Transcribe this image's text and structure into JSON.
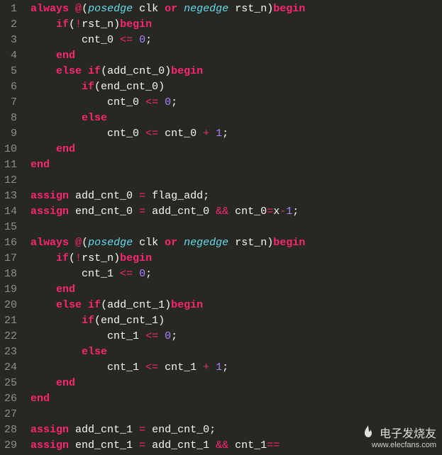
{
  "lines": [
    {
      "n": 1,
      "tokens": [
        [
          " ",
          "pn"
        ],
        [
          "always",
          "kw"
        ],
        [
          " ",
          "pn"
        ],
        [
          "@",
          "op"
        ],
        [
          "(",
          "pn"
        ],
        [
          "posedge",
          "kw2"
        ],
        [
          " ",
          "pn"
        ],
        [
          "clk",
          "id"
        ],
        [
          " ",
          "pn"
        ],
        [
          "or",
          "kw"
        ],
        [
          " ",
          "pn"
        ],
        [
          "negedge",
          "kw2"
        ],
        [
          " ",
          "pn"
        ],
        [
          "rst_n",
          "id"
        ],
        [
          ")",
          "pn"
        ],
        [
          "begin",
          "kw"
        ]
      ]
    },
    {
      "n": 2,
      "tokens": [
        [
          "     ",
          "pn"
        ],
        [
          "if",
          "kw"
        ],
        [
          "(",
          "pn"
        ],
        [
          "!",
          "op"
        ],
        [
          "rst_n",
          "id"
        ],
        [
          ")",
          "pn"
        ],
        [
          "begin",
          "kw"
        ]
      ]
    },
    {
      "n": 3,
      "tokens": [
        [
          "         ",
          "pn"
        ],
        [
          "cnt_0",
          "id"
        ],
        [
          " ",
          "pn"
        ],
        [
          "<=",
          "op"
        ],
        [
          " ",
          "pn"
        ],
        [
          "0",
          "num"
        ],
        [
          ";",
          "pn"
        ]
      ]
    },
    {
      "n": 4,
      "tokens": [
        [
          "     ",
          "pn"
        ],
        [
          "end",
          "kw"
        ]
      ]
    },
    {
      "n": 5,
      "tokens": [
        [
          "     ",
          "pn"
        ],
        [
          "else",
          "kw"
        ],
        [
          " ",
          "pn"
        ],
        [
          "if",
          "kw"
        ],
        [
          "(",
          "pn"
        ],
        [
          "add_cnt_0",
          "id"
        ],
        [
          ")",
          "pn"
        ],
        [
          "begin",
          "kw"
        ]
      ]
    },
    {
      "n": 6,
      "tokens": [
        [
          "         ",
          "pn"
        ],
        [
          "if",
          "kw"
        ],
        [
          "(",
          "pn"
        ],
        [
          "end_cnt_0",
          "id"
        ],
        [
          ")",
          "pn"
        ]
      ]
    },
    {
      "n": 7,
      "tokens": [
        [
          "             ",
          "pn"
        ],
        [
          "cnt_0",
          "id"
        ],
        [
          " ",
          "pn"
        ],
        [
          "<=",
          "op"
        ],
        [
          " ",
          "pn"
        ],
        [
          "0",
          "num"
        ],
        [
          ";",
          "pn"
        ]
      ]
    },
    {
      "n": 8,
      "tokens": [
        [
          "         ",
          "pn"
        ],
        [
          "else",
          "kw"
        ]
      ]
    },
    {
      "n": 9,
      "tokens": [
        [
          "             ",
          "pn"
        ],
        [
          "cnt_0",
          "id"
        ],
        [
          " ",
          "pn"
        ],
        [
          "<=",
          "op"
        ],
        [
          " ",
          "pn"
        ],
        [
          "cnt_0",
          "id"
        ],
        [
          " ",
          "pn"
        ],
        [
          "+",
          "op"
        ],
        [
          " ",
          "pn"
        ],
        [
          "1",
          "num"
        ],
        [
          ";",
          "pn"
        ]
      ]
    },
    {
      "n": 10,
      "tokens": [
        [
          "     ",
          "pn"
        ],
        [
          "end",
          "kw"
        ]
      ]
    },
    {
      "n": 11,
      "tokens": [
        [
          " ",
          "pn"
        ],
        [
          "end",
          "kw"
        ]
      ]
    },
    {
      "n": 12,
      "tokens": []
    },
    {
      "n": 13,
      "tokens": [
        [
          " ",
          "pn"
        ],
        [
          "assign",
          "kw"
        ],
        [
          " ",
          "pn"
        ],
        [
          "add_cnt_0",
          "id"
        ],
        [
          " ",
          "pn"
        ],
        [
          "=",
          "op"
        ],
        [
          " ",
          "pn"
        ],
        [
          "flag_add",
          "id"
        ],
        [
          ";",
          "pn"
        ]
      ]
    },
    {
      "n": 14,
      "tokens": [
        [
          " ",
          "pn"
        ],
        [
          "assign",
          "kw"
        ],
        [
          " ",
          "pn"
        ],
        [
          "end_cnt_0",
          "id"
        ],
        [
          " ",
          "pn"
        ],
        [
          "=",
          "op"
        ],
        [
          " ",
          "pn"
        ],
        [
          "add_cnt_0",
          "id"
        ],
        [
          " ",
          "pn"
        ],
        [
          "&&",
          "op"
        ],
        [
          " ",
          "pn"
        ],
        [
          "cnt_0",
          "id"
        ],
        [
          "=",
          "op"
        ],
        [
          "x",
          "id"
        ],
        [
          "-",
          "op"
        ],
        [
          "1",
          "num"
        ],
        [
          ";",
          "pn"
        ]
      ]
    },
    {
      "n": 15,
      "tokens": []
    },
    {
      "n": 16,
      "tokens": [
        [
          " ",
          "pn"
        ],
        [
          "always",
          "kw"
        ],
        [
          " ",
          "pn"
        ],
        [
          "@",
          "op"
        ],
        [
          "(",
          "pn"
        ],
        [
          "posedge",
          "kw2"
        ],
        [
          " ",
          "pn"
        ],
        [
          "clk",
          "id"
        ],
        [
          " ",
          "pn"
        ],
        [
          "or",
          "kw"
        ],
        [
          " ",
          "pn"
        ],
        [
          "negedge",
          "kw2"
        ],
        [
          " ",
          "pn"
        ],
        [
          "rst_n",
          "id"
        ],
        [
          ")",
          "pn"
        ],
        [
          "begin",
          "kw"
        ]
      ]
    },
    {
      "n": 17,
      "tokens": [
        [
          "     ",
          "pn"
        ],
        [
          "if",
          "kw"
        ],
        [
          "(",
          "pn"
        ],
        [
          "!",
          "op"
        ],
        [
          "rst_n",
          "id"
        ],
        [
          ")",
          "pn"
        ],
        [
          "begin",
          "kw"
        ]
      ]
    },
    {
      "n": 18,
      "tokens": [
        [
          "         ",
          "pn"
        ],
        [
          "cnt_1",
          "id"
        ],
        [
          " ",
          "pn"
        ],
        [
          "<=",
          "op"
        ],
        [
          " ",
          "pn"
        ],
        [
          "0",
          "num"
        ],
        [
          ";",
          "pn"
        ]
      ]
    },
    {
      "n": 19,
      "tokens": [
        [
          "     ",
          "pn"
        ],
        [
          "end",
          "kw"
        ]
      ]
    },
    {
      "n": 20,
      "tokens": [
        [
          "     ",
          "pn"
        ],
        [
          "else",
          "kw"
        ],
        [
          " ",
          "pn"
        ],
        [
          "if",
          "kw"
        ],
        [
          "(",
          "pn"
        ],
        [
          "add_cnt_1",
          "id"
        ],
        [
          ")",
          "pn"
        ],
        [
          "begin",
          "kw"
        ]
      ]
    },
    {
      "n": 21,
      "tokens": [
        [
          "         ",
          "pn"
        ],
        [
          "if",
          "kw"
        ],
        [
          "(",
          "pn"
        ],
        [
          "end_cnt_1",
          "id"
        ],
        [
          ")",
          "pn"
        ]
      ]
    },
    {
      "n": 22,
      "tokens": [
        [
          "             ",
          "pn"
        ],
        [
          "cnt_1",
          "id"
        ],
        [
          " ",
          "pn"
        ],
        [
          "<=",
          "op"
        ],
        [
          " ",
          "pn"
        ],
        [
          "0",
          "num"
        ],
        [
          ";",
          "pn"
        ]
      ]
    },
    {
      "n": 23,
      "tokens": [
        [
          "         ",
          "pn"
        ],
        [
          "else",
          "kw"
        ]
      ]
    },
    {
      "n": 24,
      "tokens": [
        [
          "             ",
          "pn"
        ],
        [
          "cnt_1",
          "id"
        ],
        [
          " ",
          "pn"
        ],
        [
          "<=",
          "op"
        ],
        [
          " ",
          "pn"
        ],
        [
          "cnt_1",
          "id"
        ],
        [
          " ",
          "pn"
        ],
        [
          "+",
          "op"
        ],
        [
          " ",
          "pn"
        ],
        [
          "1",
          "num"
        ],
        [
          ";",
          "pn"
        ]
      ]
    },
    {
      "n": 25,
      "tokens": [
        [
          "     ",
          "pn"
        ],
        [
          "end",
          "kw"
        ]
      ]
    },
    {
      "n": 26,
      "tokens": [
        [
          " ",
          "pn"
        ],
        [
          "end",
          "kw"
        ]
      ]
    },
    {
      "n": 27,
      "tokens": []
    },
    {
      "n": 28,
      "tokens": [
        [
          " ",
          "pn"
        ],
        [
          "assign",
          "kw"
        ],
        [
          " ",
          "pn"
        ],
        [
          "add_cnt_1",
          "id"
        ],
        [
          " ",
          "pn"
        ],
        [
          "=",
          "op"
        ],
        [
          " ",
          "pn"
        ],
        [
          "end_cnt_0",
          "id"
        ],
        [
          ";",
          "pn"
        ]
      ]
    },
    {
      "n": 29,
      "tokens": [
        [
          " ",
          "pn"
        ],
        [
          "assign",
          "kw"
        ],
        [
          " ",
          "pn"
        ],
        [
          "end_cnt_1",
          "id"
        ],
        [
          " ",
          "pn"
        ],
        [
          "=",
          "op"
        ],
        [
          " ",
          "pn"
        ],
        [
          "add_cnt_1",
          "id"
        ],
        [
          " ",
          "pn"
        ],
        [
          "&&",
          "op"
        ],
        [
          " ",
          "pn"
        ],
        [
          "cnt_1",
          "id"
        ],
        [
          "==",
          "op"
        ]
      ]
    }
  ],
  "watermark": {
    "brand": "电子发烧友",
    "url": "www.elecfans.com"
  }
}
